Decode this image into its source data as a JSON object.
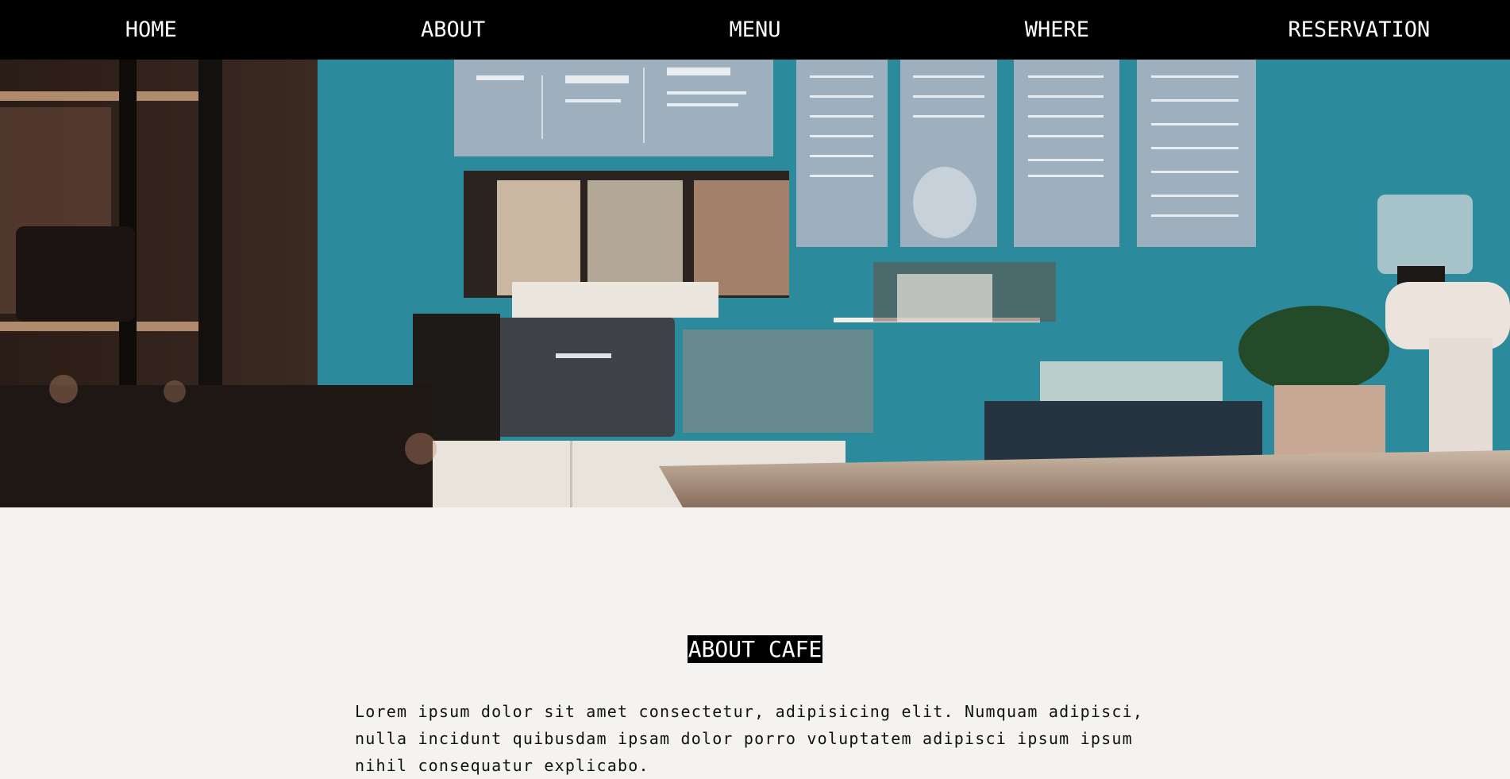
{
  "nav": {
    "items": [
      {
        "label": "HOME"
      },
      {
        "label": "ABOUT"
      },
      {
        "label": "MENU"
      },
      {
        "label": "WHERE"
      },
      {
        "label": "RESERVATION"
      }
    ]
  },
  "hero": {
    "colors": {
      "wall": "#2b8a9c",
      "counter": "#e8e3db",
      "shadow": "#1e1714"
    }
  },
  "about": {
    "title": "ABOUT CAFE",
    "text": "Lorem ipsum dolor sit amet consectetur, adipisicing elit. Numquam adipisci, nulla incidunt quibusdam ipsam dolor porro voluptatem adipisci ipsum ipsum nihil consequatur explicabo."
  },
  "colors": {
    "nav_bg": "#000000",
    "page_bg": "#f4f3ef",
    "text": "#111111"
  }
}
